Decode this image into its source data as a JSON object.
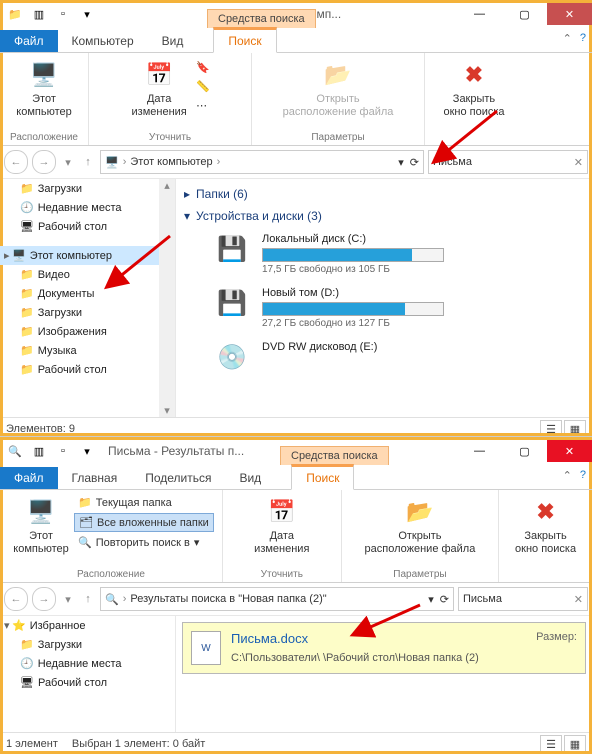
{
  "win1": {
    "ctx_label": "Средства поиска",
    "title": "Письма - Этот комп...",
    "tabs": {
      "file": "Файл",
      "computer": "Компьютер",
      "view": "Вид",
      "search": "Поиск"
    },
    "ribbon": {
      "this_pc": "Этот\nкомпьютер",
      "date": "Дата\nизменения",
      "open_loc": "Открыть\nрасположение файла",
      "close_search": "Закрыть\nокно поиска",
      "g_location": "Расположение",
      "g_refine": "Уточнить",
      "g_params": "Параметры"
    },
    "breadcrumb": {
      "root": "Этот компьютер"
    },
    "search_value": "Письма",
    "tree": {
      "downloads": "Загрузки",
      "recent": "Недавние места",
      "desktop": "Рабочий стол",
      "this_pc": "Этот компьютер",
      "video": "Видео",
      "documents": "Документы",
      "downloads2": "Загрузки",
      "pictures": "Изображения",
      "music": "Музыка",
      "desktop2": "Рабочий стол"
    },
    "content": {
      "folders_hdr": "Папки (6)",
      "drives_hdr": "Устройства и диски (3)",
      "drives": [
        {
          "name": "Локальный диск (C:)",
          "free": "17,5 ГБ свободно из 105 ГБ",
          "pct": 83
        },
        {
          "name": "Новый том (D:)",
          "free": "27,2 ГБ свободно из 127 ГБ",
          "pct": 79
        }
      ],
      "dvd": "DVD RW дисковод (E:)"
    },
    "status": "Элементов: 9"
  },
  "win2": {
    "title": "Письма - Результаты п...",
    "ctx_label": "Средства поиска",
    "tabs": {
      "file": "Файл",
      "home": "Главная",
      "share": "Поделиться",
      "view": "Вид",
      "search": "Поиск"
    },
    "ribbon": {
      "this_pc": "Этот\nкомпьютер",
      "cur_folder": "Текущая папка",
      "all_sub": "Все вложенные папки",
      "search_again": "Повторить поиск в",
      "date": "Дата\nизменения",
      "open_loc": "Открыть\nрасположение файла",
      "close_search": "Закрыть\nокно поиска",
      "g_location": "Расположение",
      "g_refine": "Уточнить",
      "g_params": "Параметры"
    },
    "breadcrumb": "Результаты поиска в \"Новая папка (2)\"",
    "search_value": "Письма",
    "tree": {
      "favorites": "Избранное",
      "downloads": "Загрузки",
      "recent": "Недавние места",
      "desktop": "Рабочий стол"
    },
    "result": {
      "name": "Письма.docx",
      "size_label": "Размер:",
      "path": "C:\\Пользователи\\            \\Рабочий стол\\Новая папка (2)"
    },
    "status_left": "1 элемент",
    "status_mid": "Выбран 1 элемент: 0 байт"
  }
}
